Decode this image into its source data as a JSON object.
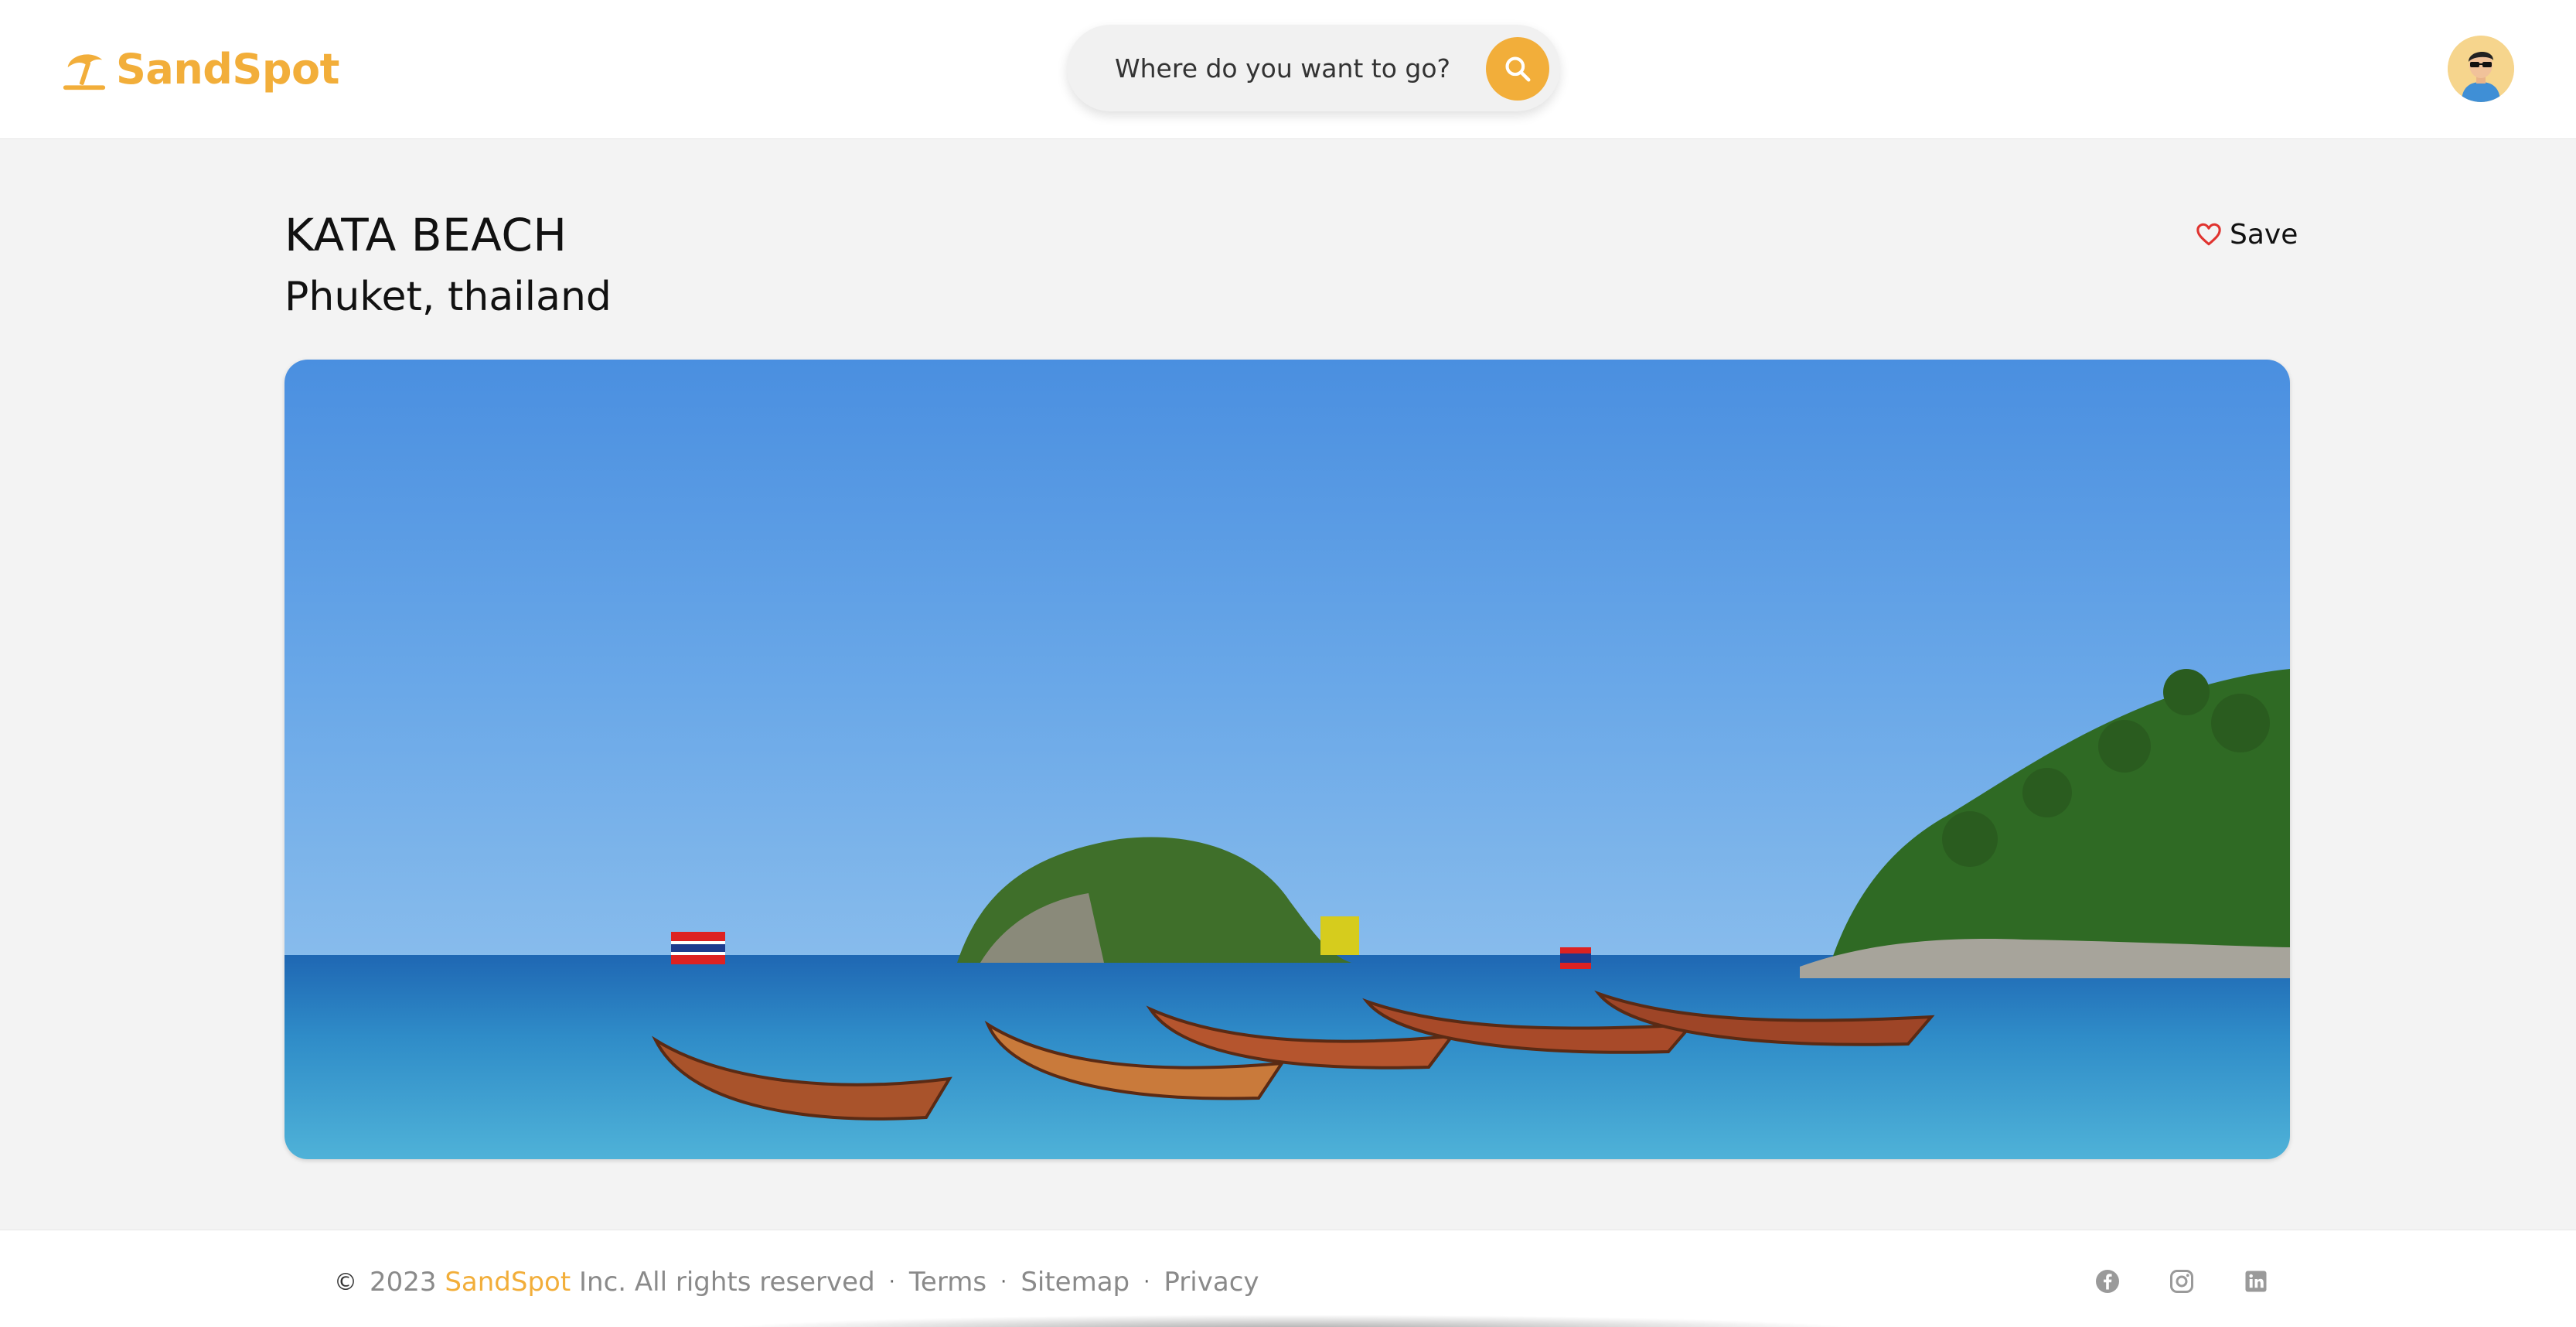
{
  "header": {
    "logo_text": "SandSpot",
    "search_placeholder": "Where do you want to go?",
    "icons": {
      "logo": "beach-umbrella-icon",
      "search": "search-icon",
      "avatar": "user-avatar"
    }
  },
  "place": {
    "title": "KATA BEACH",
    "subtitle": "Phuket, thailand",
    "save_label": "Save",
    "save_icon": "heart-icon"
  },
  "hero_image": {
    "description_icon": "beach-photo"
  },
  "footer": {
    "copyright_symbol": "©",
    "year": "2023",
    "brand": "SandSpot",
    "rights": "Inc. All rights reserved",
    "separator": "·",
    "links": [
      "Terms",
      "Sitemap",
      "Privacy"
    ],
    "social": [
      "facebook-icon",
      "instagram-icon",
      "linkedin-icon"
    ]
  },
  "colors": {
    "accent": "#f2ae3a",
    "background": "#f3f3f3",
    "heart": "#e0332f"
  }
}
